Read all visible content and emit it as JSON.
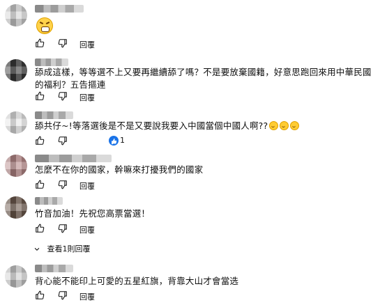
{
  "comments": [
    {
      "text": "",
      "has_emoji": true,
      "reply_label": "回覆"
    },
    {
      "text": "舔成這樣，等等選不上又要再繼續舔了嗎？不是要放棄國籍，好意思跑回來用中華民國的福利？五告摳連",
      "reply_label": "回覆"
    },
    {
      "text": "舔共仔~!等落選後是不是又要說我要入中國當個中國人啊??",
      "reply_label": "",
      "likes": "1"
    },
    {
      "text": "怎麼不在你的國家，幹嘛來打擾我們的國家",
      "reply_label": "回覆"
    },
    {
      "text": "竹音加油！先祝您高票當選！",
      "reply_label": "回覆"
    },
    {
      "text": "背心能不能印上可愛的五星紅旗，背靠大山才會當选",
      "reply_label": "回覆"
    }
  ],
  "view_replies": "查看1則回覆",
  "icons": {
    "like": "thumb-up-icon",
    "dislike": "thumb-down-icon",
    "creator": "creator-heart-icon",
    "expand": "chevron-down-icon"
  },
  "colors": {
    "text": "#0f0f0f",
    "accent": "#1a73e8",
    "icon": "#0f0f0f"
  }
}
